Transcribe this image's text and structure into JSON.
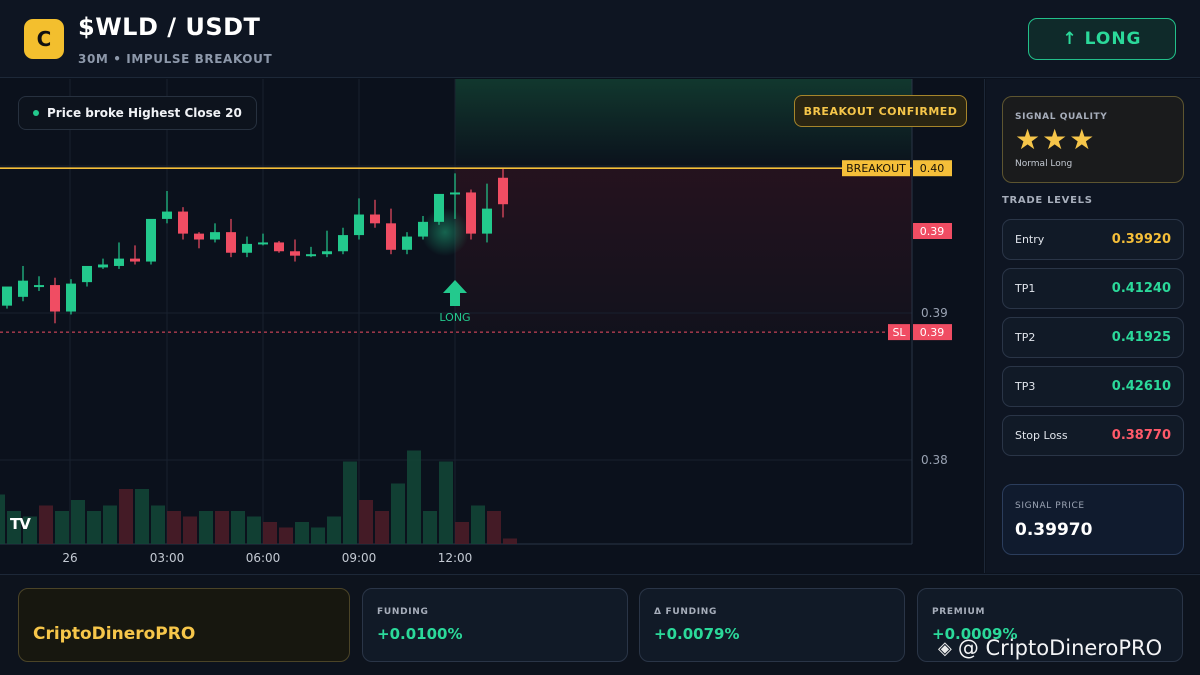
{
  "header": {
    "logo_letter": "C",
    "pair": "$WLD / USDT",
    "subtitle": "30M • IMPULSE BREAKOUT",
    "action_label": "↑ LONG"
  },
  "chart": {
    "status_pill": "Price broke Highest Close 20",
    "confirm_label": "BREAKOUT CONFIRMED",
    "tv_logo": "TV",
    "long_marker_label": "LONG",
    "breakout_label": "BREAKOUT",
    "breakout_value": "0.40",
    "current_price_label": "0.39",
    "sl_label": "SL",
    "sl_value": "0.39",
    "y_ticks": [
      "0.40",
      "0.39",
      "0.38"
    ],
    "x_ticks": [
      "26",
      "03:00",
      "06:00",
      "09:00",
      "12:00"
    ]
  },
  "chart_data": {
    "type": "candlestick",
    "breakout_level": 0.39985,
    "stop_loss_level": 0.3887,
    "y_axis_ticks": [
      "0.40",
      "0.39",
      "0.38"
    ],
    "x_axis_ticks": [
      "26",
      "03:00",
      "06:00",
      "09:00",
      "12:00"
    ],
    "candles": [
      {
        "o": 0.3905,
        "h": 0.3915,
        "c": 0.3918,
        "l": 0.3903
      },
      {
        "o": 0.3911,
        "h": 0.3932,
        "c": 0.3922,
        "l": 0.3908
      },
      {
        "o": 0.3919,
        "h": 0.3925,
        "c": 0.3919,
        "l": 0.3915
      },
      {
        "o": 0.3919,
        "h": 0.3924,
        "c": 0.3901,
        "l": 0.3893
      },
      {
        "o": 0.3901,
        "h": 0.3923,
        "c": 0.392,
        "l": 0.3899
      },
      {
        "o": 0.3921,
        "h": 0.3928,
        "c": 0.3932,
        "l": 0.3918
      },
      {
        "o": 0.3931,
        "h": 0.3937,
        "c": 0.3933,
        "l": 0.393
      },
      {
        "o": 0.3932,
        "h": 0.3948,
        "c": 0.3937,
        "l": 0.393
      },
      {
        "o": 0.3937,
        "h": 0.3946,
        "c": 0.3935,
        "l": 0.3933
      },
      {
        "o": 0.3935,
        "h": 0.3961,
        "c": 0.3964,
        "l": 0.3933
      },
      {
        "o": 0.3964,
        "h": 0.3983,
        "c": 0.3969,
        "l": 0.3961
      },
      {
        "o": 0.3969,
        "h": 0.3972,
        "c": 0.3954,
        "l": 0.395
      },
      {
        "o": 0.3954,
        "h": 0.3955,
        "c": 0.395,
        "l": 0.3944
      },
      {
        "o": 0.395,
        "h": 0.3961,
        "c": 0.3955,
        "l": 0.3948
      },
      {
        "o": 0.3955,
        "h": 0.3964,
        "c": 0.3941,
        "l": 0.3938
      },
      {
        "o": 0.3941,
        "h": 0.3952,
        "c": 0.3947,
        "l": 0.3938
      },
      {
        "o": 0.3947,
        "h": 0.3954,
        "c": 0.3948,
        "l": 0.3946
      },
      {
        "o": 0.3948,
        "h": 0.3949,
        "c": 0.3942,
        "l": 0.3941
      },
      {
        "o": 0.3942,
        "h": 0.395,
        "c": 0.3939,
        "l": 0.3935
      },
      {
        "o": 0.3939,
        "h": 0.3945,
        "c": 0.394,
        "l": 0.3938
      },
      {
        "o": 0.394,
        "h": 0.3956,
        "c": 0.3942,
        "l": 0.3938
      },
      {
        "o": 0.3942,
        "h": 0.3958,
        "c": 0.3953,
        "l": 0.394
      },
      {
        "o": 0.3953,
        "h": 0.3978,
        "c": 0.3967,
        "l": 0.395
      },
      {
        "o": 0.3967,
        "h": 0.3977,
        "c": 0.3961,
        "l": 0.3958
      },
      {
        "o": 0.3961,
        "h": 0.3971,
        "c": 0.3943,
        "l": 0.394
      },
      {
        "o": 0.3943,
        "h": 0.3955,
        "c": 0.3952,
        "l": 0.394
      },
      {
        "o": 0.3952,
        "h": 0.3966,
        "c": 0.3962,
        "l": 0.395
      },
      {
        "o": 0.3962,
        "h": 0.3974,
        "c": 0.3981,
        "l": 0.396
      },
      {
        "o": 0.3981,
        "h": 0.3995,
        "c": 0.3982,
        "l": 0.3964
      },
      {
        "o": 0.3982,
        "h": 0.3984,
        "c": 0.3954,
        "l": 0.395
      },
      {
        "o": 0.3954,
        "h": 0.3988,
        "c": 0.3971,
        "l": 0.3948
      },
      {
        "o": 0.3992,
        "h": 0.3998,
        "c": 0.3974,
        "l": 0.3965
      }
    ],
    "volume": [
      0.9,
      0.6,
      0.5,
      0.7,
      0.6,
      0.8,
      0.6,
      0.7,
      1.0,
      1.0,
      0.7,
      0.6,
      0.5,
      0.6,
      0.6,
      0.6,
      0.5,
      0.4,
      0.3,
      0.4,
      0.3,
      0.5,
      1.5,
      0.8,
      0.6,
      1.1,
      1.7,
      0.6,
      1.5,
      0.4,
      0.7,
      0.6,
      0.1
    ]
  },
  "signal_quality": {
    "caption": "SIGNAL QUALITY",
    "stars": "★★★",
    "note": "Normal Long"
  },
  "trade_levels": {
    "title": "TRADE LEVELS",
    "items": [
      {
        "label": "Entry",
        "value": "0.39920",
        "color": "#f5bf39"
      },
      {
        "label": "TP1",
        "value": "0.41240",
        "color": "#2bd99a"
      },
      {
        "label": "TP2",
        "value": "0.41925",
        "color": "#2bd99a"
      },
      {
        "label": "TP3",
        "value": "0.42610",
        "color": "#2bd99a"
      },
      {
        "label": "Stop Loss",
        "value": "0.38770",
        "color": "#ff5a6a"
      }
    ]
  },
  "signal_price": {
    "caption": "SIGNAL PRICE",
    "value": "0.39970"
  },
  "footer": {
    "brand": "CriptoDineroPRO",
    "stats": [
      {
        "caption": "FUNDING",
        "value": "+0.0100%"
      },
      {
        "caption": "Δ FUNDING",
        "value": "+0.0079%"
      },
      {
        "caption": "PREMIUM",
        "value": "+0.0009%"
      }
    ],
    "watermark": "@ CriptoDineroPRO"
  },
  "colors": {
    "accent_yellow": "#f5bf39",
    "up": "#23c98d",
    "down": "#f04d63",
    "background": "#0b111c"
  }
}
